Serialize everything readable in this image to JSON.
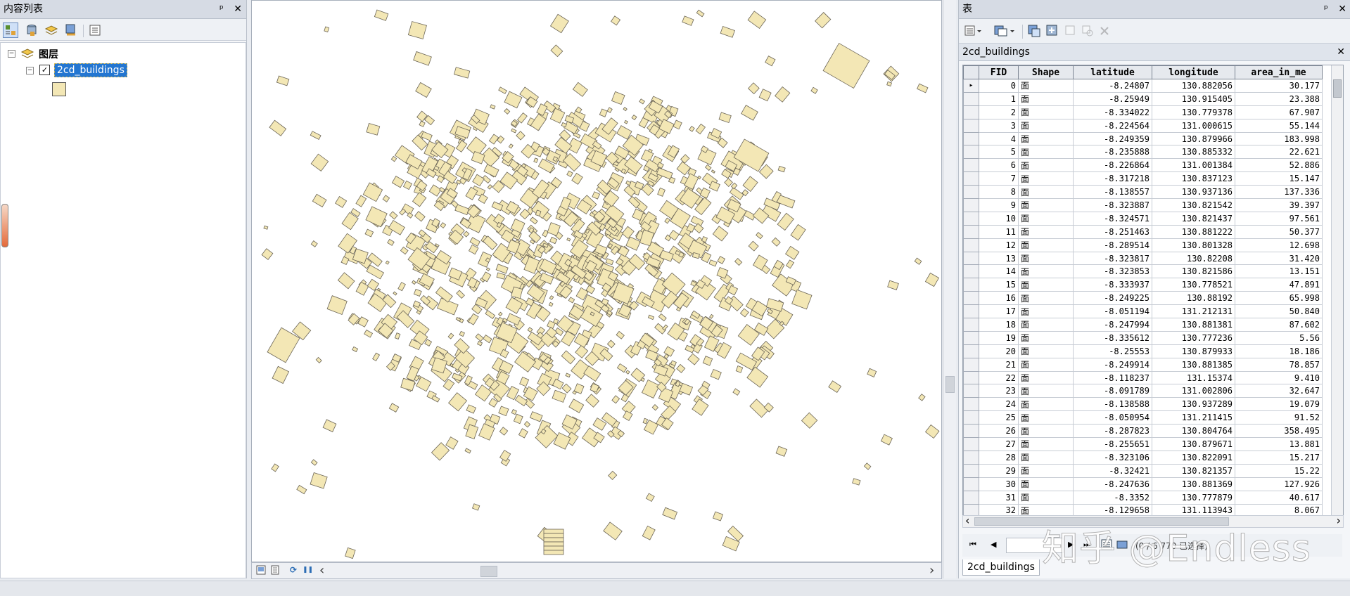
{
  "toc": {
    "title": "内容列表",
    "pin_glyph": "ᵖ",
    "close_glyph": "✕",
    "root_label": "图层",
    "layer_label": "2cd_buildings",
    "layer_checked": "✓",
    "expander_collapse": "⊟",
    "icons": [
      "list-by-drawing-order-icon",
      "list-by-source-icon",
      "list-by-visibility-icon",
      "list-by-selection-icon",
      "options-icon"
    ]
  },
  "table": {
    "title": "表",
    "pin_glyph": "ᵖ",
    "close_glyph": "✕",
    "tab_title": "2cd_buildings",
    "tab_close": "✕",
    "columns": [
      "FID",
      "Shape",
      "latitude",
      "longitude",
      "area_in_me"
    ],
    "rows": [
      [
        "0",
        "面",
        "-8.24807",
        "130.882056",
        "30.177"
      ],
      [
        "1",
        "面",
        "-8.25949",
        "130.915405",
        "23.388"
      ],
      [
        "2",
        "面",
        "-8.334022",
        "130.779378",
        "67.907"
      ],
      [
        "3",
        "面",
        "-8.224564",
        "131.000615",
        "55.144"
      ],
      [
        "4",
        "面",
        "-8.249359",
        "130.879966",
        "183.998"
      ],
      [
        "5",
        "面",
        "-8.235888",
        "130.885332",
        "22.621"
      ],
      [
        "6",
        "面",
        "-8.226864",
        "131.001384",
        "52.886"
      ],
      [
        "7",
        "面",
        "-8.317218",
        "130.837123",
        "15.147"
      ],
      [
        "8",
        "面",
        "-8.138557",
        "130.937136",
        "137.336"
      ],
      [
        "9",
        "面",
        "-8.323887",
        "130.821542",
        "39.397"
      ],
      [
        "10",
        "面",
        "-8.324571",
        "130.821437",
        "97.561"
      ],
      [
        "11",
        "面",
        "-8.251463",
        "130.881222",
        "50.377"
      ],
      [
        "12",
        "面",
        "-8.289514",
        "130.801328",
        "12.698"
      ],
      [
        "13",
        "面",
        "-8.323817",
        "130.82208",
        "31.420"
      ],
      [
        "14",
        "面",
        "-8.323853",
        "130.821586",
        "13.151"
      ],
      [
        "15",
        "面",
        "-8.333937",
        "130.778521",
        "47.891"
      ],
      [
        "16",
        "面",
        "-8.249225",
        "130.88192",
        "65.998"
      ],
      [
        "17",
        "面",
        "-8.051194",
        "131.212131",
        "50.840"
      ],
      [
        "18",
        "面",
        "-8.247994",
        "130.881381",
        "87.602"
      ],
      [
        "19",
        "面",
        "-8.335612",
        "130.777236",
        "5.56"
      ],
      [
        "20",
        "面",
        "-8.25553",
        "130.879933",
        "18.186"
      ],
      [
        "21",
        "面",
        "-8.249914",
        "130.881385",
        "78.857"
      ],
      [
        "22",
        "面",
        "-8.118237",
        "131.15374",
        "9.410"
      ],
      [
        "23",
        "面",
        "-8.091789",
        "131.002806",
        "32.647"
      ],
      [
        "24",
        "面",
        "-8.138588",
        "130.937289",
        "19.079"
      ],
      [
        "25",
        "面",
        "-8.050954",
        "131.211415",
        "91.52"
      ],
      [
        "26",
        "面",
        "-8.287823",
        "130.804764",
        "358.495"
      ],
      [
        "27",
        "面",
        "-8.255651",
        "130.879671",
        "13.881"
      ],
      [
        "28",
        "面",
        "-8.323106",
        "130.822091",
        "15.217"
      ],
      [
        "29",
        "面",
        "-8.32421",
        "130.821357",
        "15.22"
      ],
      [
        "30",
        "面",
        "-8.247636",
        "130.881369",
        "127.926"
      ],
      [
        "31",
        "面",
        "-8.3352",
        "130.777879",
        "40.617"
      ],
      [
        "32",
        "面",
        "-8.129658",
        "131.113943",
        "8.067"
      ]
    ],
    "nav": {
      "first": "⏮",
      "prev": "◀",
      "next": "▶",
      "last": "⏭",
      "record_text": "(0 / 6 770 已选择)"
    },
    "bottom_tab": "2cd_buildings",
    "scroll_left": "‹",
    "scroll_right": "›"
  },
  "mapbar": {
    "scroll_left": "‹",
    "scroll_right": "›",
    "refresh_glyph": "⟳",
    "pause_glyph": "❚❚"
  },
  "watermark": "知乎 @Endless",
  "colors": {
    "building_fill": "#f3e7b5",
    "building_outline": "#6b6557",
    "selection": "#2376d1"
  }
}
